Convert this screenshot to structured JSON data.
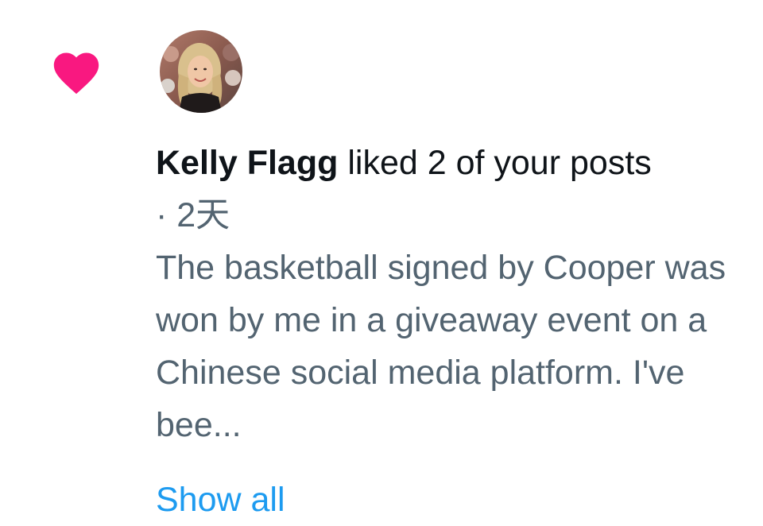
{
  "notification": {
    "type_icon": "heart-icon",
    "accent_color": "#f91880",
    "avatar_icon": "user-avatar",
    "user_name": "Kelly Flagg",
    "action_text": " liked 2 of your posts",
    "time": "· 2天",
    "post_text": "The basketball signed by Cooper was won by me in a giveaway event on a Chinese social media platform. I've bee...",
    "show_all_label": "Show all"
  }
}
